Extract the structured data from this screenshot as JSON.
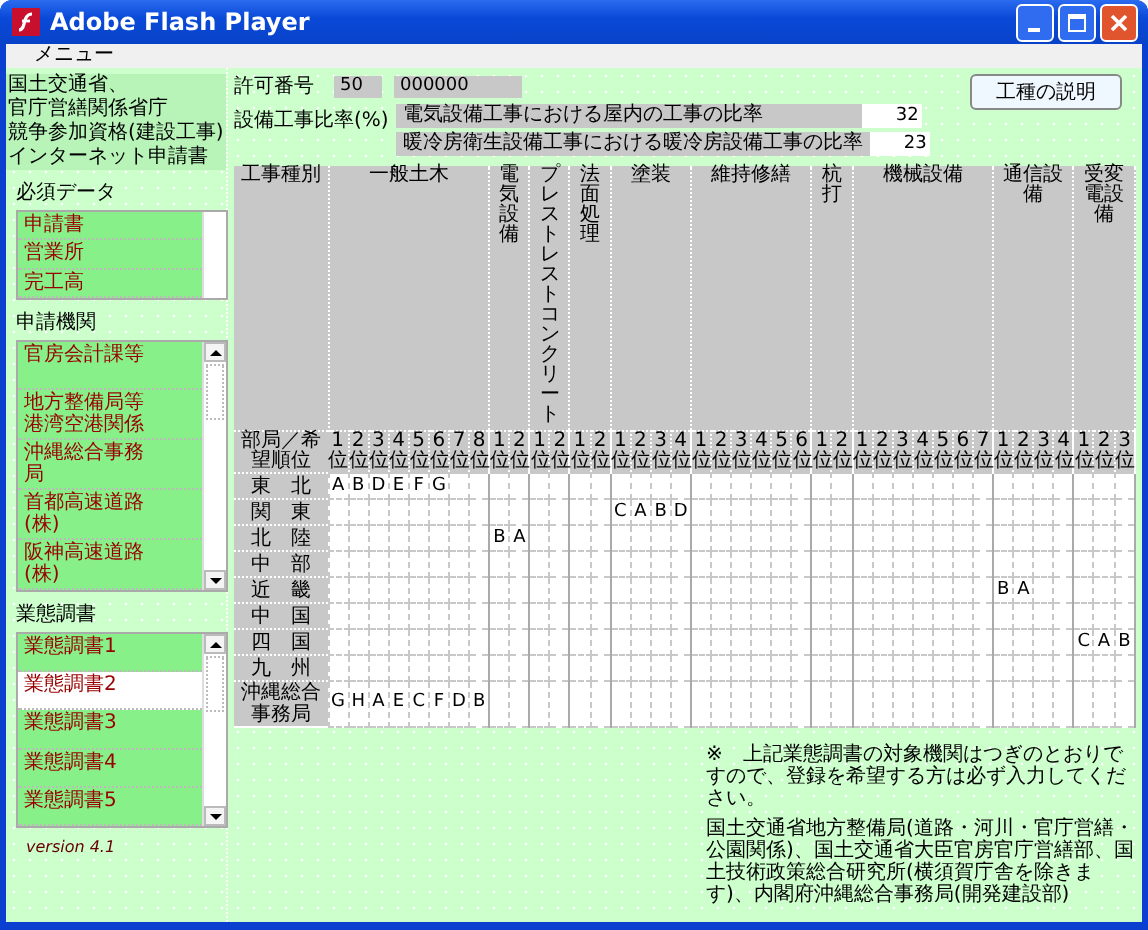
{
  "window": {
    "title": "Adobe Flash Player"
  },
  "menu": [
    "メニュー"
  ],
  "app_title": [
    "国土交通省、",
    "官庁営繕関係省庁",
    "競争参加資格(建設工事)",
    "インターネット申請書"
  ],
  "permit": {
    "label": "許可番号",
    "code": "50",
    "number": "000000"
  },
  "help_button": "工種の説明",
  "ratio": {
    "label": "設備工事比率(%)",
    "rows": [
      {
        "label": "電気設備工事における屋内の工事の比率",
        "value": "32"
      },
      {
        "label": "暖冷房衛生設備工事における暖冷房設備工事の比率",
        "value": "23"
      }
    ]
  },
  "sections": [
    {
      "title": "必須データ",
      "kind": "short",
      "scrollable": false,
      "items": [
        {
          "label": "申請書",
          "selected": false
        },
        {
          "label": "営業所",
          "selected": false
        },
        {
          "label": "完工高",
          "selected": false
        }
      ]
    },
    {
      "title": "申請機関",
      "kind": "tall",
      "scrollable": true,
      "items": [
        {
          "label": "官房会計課等",
          "selected": false
        },
        {
          "label": "地方整備局等港湾空港関係",
          "selected": false
        },
        {
          "label": "沖縄総合事務局",
          "selected": false
        },
        {
          "label": "首都高速道路(株)",
          "selected": false
        },
        {
          "label": "阪神高速道路(株)",
          "selected": false
        }
      ]
    },
    {
      "title": "業態調書",
      "kind": "medium",
      "scrollable": true,
      "items": [
        {
          "label": "業態調書1",
          "selected": false
        },
        {
          "label": "業態調書2",
          "selected": true
        },
        {
          "label": "業態調書3",
          "selected": false
        },
        {
          "label": "業態調書4",
          "selected": false
        },
        {
          "label": "業態調書5",
          "selected": false
        }
      ]
    }
  ],
  "version": "version 4.1",
  "table": {
    "corner_top": "工事種別",
    "corner_bottom": "部局／希望順位",
    "groups": [
      {
        "label": "一般土木",
        "ranks": [
          "1位",
          "2位",
          "3位",
          "4位",
          "5位",
          "6位",
          "7位",
          "8位"
        ]
      },
      {
        "label": "電気設備",
        "ranks": [
          "1位",
          "2位"
        ]
      },
      {
        "label": "プレストレストコンクリート",
        "ranks": [
          "1位",
          "2位"
        ]
      },
      {
        "label": "法面処理",
        "ranks": [
          "1位",
          "2位"
        ]
      },
      {
        "label": "塗装",
        "ranks": [
          "1位",
          "2位",
          "3位",
          "4位"
        ]
      },
      {
        "label": "維持修繕",
        "ranks": [
          "1位",
          "2位",
          "3位",
          "4位",
          "5位",
          "6位"
        ]
      },
      {
        "label": "杭打",
        "ranks": [
          "1位",
          "2位"
        ]
      },
      {
        "label": "機械設備",
        "ranks": [
          "1位",
          "2位",
          "3位",
          "4位",
          "5位",
          "6位",
          "7位"
        ]
      },
      {
        "label": "通信設備",
        "ranks": [
          "1位",
          "2位",
          "3位",
          "4位"
        ]
      },
      {
        "label": "受変電設備",
        "ranks": [
          "1位",
          "2位",
          "3位"
        ]
      }
    ],
    "rows": [
      {
        "region": "東　北",
        "cells": [
          "A",
          "B",
          "D",
          "E",
          "F",
          "G",
          null,
          null,
          null,
          null,
          null,
          null,
          null,
          null,
          null,
          null,
          null,
          null,
          null,
          null,
          null,
          null,
          null,
          null,
          null,
          null,
          null,
          null,
          null,
          null,
          null,
          null,
          null,
          null,
          null,
          null,
          null,
          null,
          null,
          null
        ]
      },
      {
        "region": "関　東",
        "cells": [
          null,
          null,
          null,
          null,
          null,
          null,
          null,
          null,
          null,
          null,
          null,
          null,
          null,
          null,
          "C",
          "A",
          "B",
          "D",
          null,
          null,
          null,
          null,
          null,
          null,
          null,
          null,
          null,
          null,
          null,
          null,
          null,
          null,
          null,
          null,
          null,
          null,
          null,
          null,
          null,
          null
        ]
      },
      {
        "region": "北　陸",
        "cells": [
          null,
          null,
          null,
          null,
          null,
          null,
          null,
          null,
          "B",
          "A",
          null,
          null,
          null,
          null,
          null,
          null,
          null,
          null,
          null,
          null,
          null,
          null,
          null,
          null,
          null,
          null,
          null,
          null,
          null,
          null,
          null,
          null,
          null,
          null,
          null,
          null,
          null,
          null,
          null,
          null
        ]
      },
      {
        "region": "中　部",
        "cells": [
          null,
          null,
          null,
          null,
          null,
          null,
          null,
          null,
          null,
          null,
          null,
          null,
          null,
          null,
          null,
          null,
          null,
          null,
          null,
          null,
          null,
          null,
          null,
          null,
          null,
          null,
          null,
          null,
          null,
          null,
          null,
          null,
          null,
          null,
          null,
          null,
          null,
          null,
          null,
          null
        ]
      },
      {
        "region": "近　畿",
        "cells": [
          null,
          null,
          null,
          null,
          null,
          null,
          null,
          null,
          null,
          null,
          null,
          null,
          null,
          null,
          null,
          null,
          null,
          null,
          null,
          null,
          null,
          null,
          null,
          null,
          null,
          null,
          null,
          null,
          null,
          null,
          null,
          null,
          null,
          "B",
          "A",
          null,
          null,
          null,
          null,
          null
        ]
      },
      {
        "region": "中　国",
        "cells": [
          null,
          null,
          null,
          null,
          null,
          null,
          null,
          null,
          null,
          null,
          null,
          null,
          null,
          null,
          null,
          null,
          null,
          null,
          null,
          null,
          null,
          null,
          null,
          null,
          null,
          null,
          null,
          null,
          null,
          null,
          null,
          null,
          null,
          null,
          null,
          null,
          null,
          null,
          null,
          null
        ]
      },
      {
        "region": "四　国",
        "cells": [
          null,
          null,
          null,
          null,
          null,
          null,
          null,
          null,
          null,
          null,
          null,
          null,
          null,
          null,
          null,
          null,
          null,
          null,
          null,
          null,
          null,
          null,
          null,
          null,
          null,
          null,
          null,
          null,
          null,
          null,
          null,
          null,
          null,
          null,
          null,
          null,
          null,
          "C",
          "A",
          "B"
        ]
      },
      {
        "region": "九　州",
        "cells": [
          null,
          null,
          null,
          null,
          null,
          null,
          null,
          null,
          null,
          null,
          null,
          null,
          null,
          null,
          null,
          null,
          null,
          null,
          null,
          null,
          null,
          null,
          null,
          null,
          null,
          null,
          null,
          null,
          null,
          null,
          null,
          null,
          null,
          null,
          null,
          null,
          null,
          null,
          null,
          null
        ]
      },
      {
        "region": "沖縄総合事務局",
        "cells": [
          "G",
          "H",
          "A",
          "E",
          "C",
          "F",
          "D",
          "B",
          null,
          null,
          null,
          null,
          null,
          null,
          null,
          null,
          null,
          null,
          null,
          null,
          null,
          null,
          null,
          null,
          null,
          null,
          null,
          null,
          null,
          null,
          null,
          null,
          null,
          null,
          null,
          null,
          null,
          null,
          null,
          null
        ]
      }
    ]
  },
  "note": [
    "※　上記業態調書の対象機関はつぎのとおりですので、登録を希望する方は必ず入力してください。",
    "国土交通省地方整備局(道路・河川・官庁営繕・公園関係)、国土交通省大臣官房官庁営繕部、国土技術政策総合研究所(横須賀庁舎を除きます)、内閣府沖縄総合事務局(開発建設部)"
  ]
}
